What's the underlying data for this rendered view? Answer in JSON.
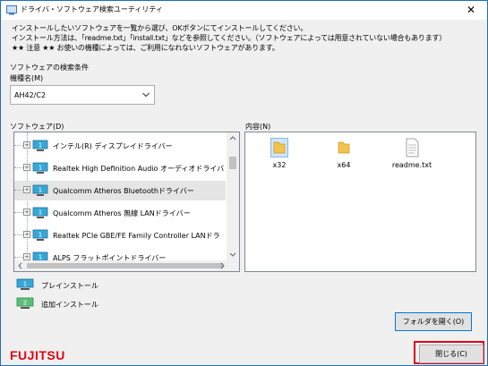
{
  "window": {
    "title": "ドライバ・ソフトウェア検索ユーティリティ",
    "close_glyph": "✕"
  },
  "message": {
    "line1": "インストールしたいソフトウェアを一覧から選び、OKボタンにてインストールしてください。",
    "line2": "インストール方法は、「readme.txt」「install.txt」などを参照してください。（ソフトウェアによっては用意されていない場合もあります）",
    "line3": "★★ 注意 ★★ お使いの機種によっては、ご利用になれないソフトウェアがあります。"
  },
  "search": {
    "section_label": "ソフトウェアの検索条件",
    "model_label": "機種名(M)",
    "model_value": "AH42/C2"
  },
  "software": {
    "label": "ソフトウェア(D)",
    "items": [
      {
        "label": "インテル(R) ディスプレイドライバー",
        "selected": false
      },
      {
        "label": "Realtek High Definition Audio オーディオドライバ",
        "selected": false
      },
      {
        "label": "Qualcomm Atheros Bluetoothドライバー",
        "selected": true
      },
      {
        "label": "Qualcomm Atheros 無線 LANドライバー",
        "selected": false
      },
      {
        "label": "Realtek PCIe GBE/FE Family Controller LANドラ",
        "selected": false
      },
      {
        "label": "ALPS フラットポイントドライバー",
        "selected": false
      }
    ]
  },
  "contents": {
    "label": "内容(N)",
    "files": [
      {
        "name": "x32",
        "type": "folder",
        "selected": true
      },
      {
        "name": "x64",
        "type": "folder",
        "selected": false
      },
      {
        "name": "readme.txt",
        "type": "text",
        "selected": false
      }
    ]
  },
  "legend": {
    "preinstall": "プレインストール",
    "additional": "追加インストール"
  },
  "buttons": {
    "open_folder": "フォルダを開く(O)",
    "close": "閉じる(C)"
  },
  "brand": {
    "logo_text": "FUJITSU",
    "color": "#e60012"
  },
  "colors": {
    "accent": "#0078d7",
    "highlight_box": "#e0001a"
  }
}
